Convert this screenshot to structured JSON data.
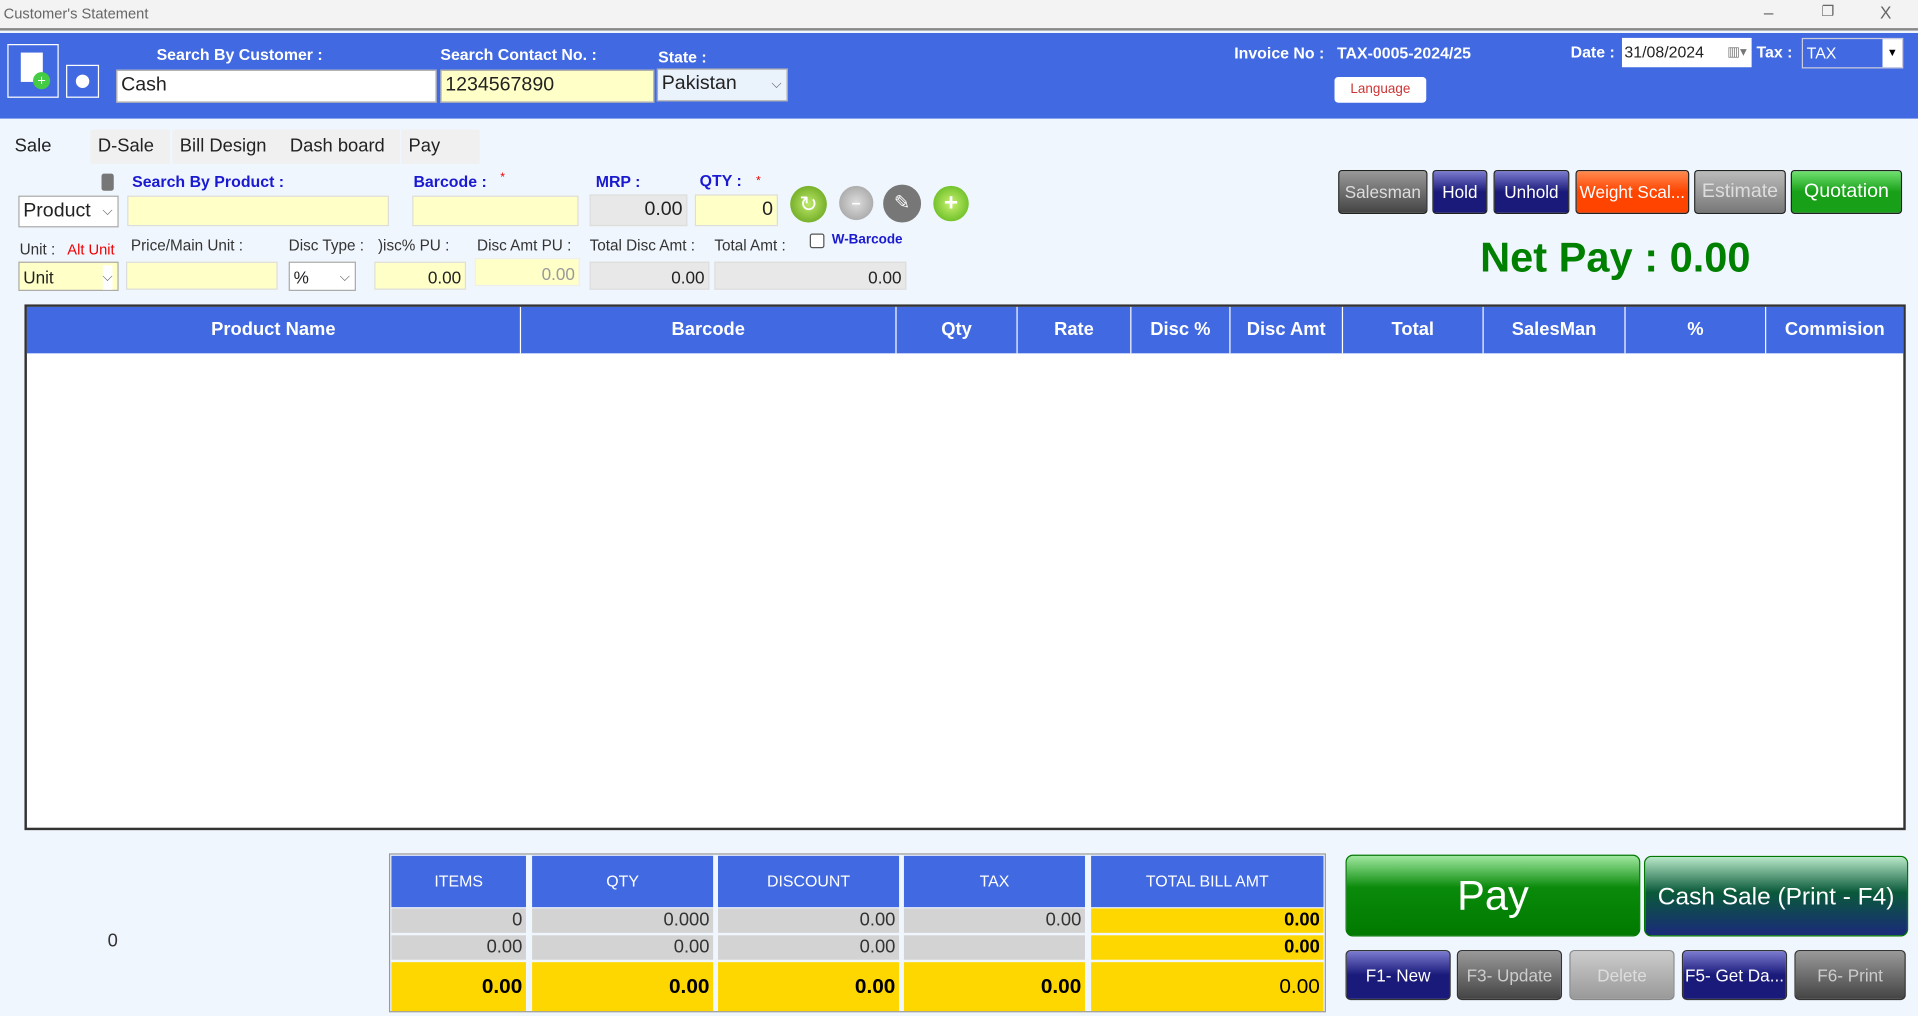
{
  "window": {
    "title": "Customer's Statement",
    "minimize": "–",
    "restore": "❐",
    "close": "X"
  },
  "header": {
    "search_customer_label": "Search By Customer :",
    "search_customer_value": "Cash",
    "search_contact_label": "Search Contact No. :",
    "search_contact_value": "1234567890",
    "state_label": "State :",
    "state_value": "Pakistan",
    "invoice_label": "Invoice No :",
    "invoice_value": "TAX-0005-2024/25",
    "language_button": "Language",
    "date_label": "Date :",
    "date_value": "31/08/2024",
    "tax_label": "Tax :",
    "tax_value": "TAX"
  },
  "tabs": [
    {
      "label": "Sale"
    },
    {
      "label": "D-Sale"
    },
    {
      "label": "Bill Design"
    },
    {
      "label": "Dash board"
    },
    {
      "label": "Pay"
    }
  ],
  "entry": {
    "product_type": "Product",
    "search_product_label": "Search By Product :",
    "search_product_value": "",
    "barcode_label": "Barcode :",
    "barcode_value": "",
    "required_mark": "*",
    "mrp_label": "MRP :",
    "mrp_value": "0.00",
    "qty_label": "QTY :",
    "qty_value": "0",
    "unit_label": "Unit :",
    "alt_unit_label": "Alt Unit",
    "unit_value": "Unit",
    "price_label": "Price/Main Unit :",
    "price_value": "",
    "disc_type_label": "Disc Type :",
    "disc_type_value": "%",
    "disc_pct_label": ")isc% PU :",
    "disc_pct_value": "0.00",
    "disc_amt_label": "Disc Amt PU :",
    "disc_amt_value": "0.00",
    "total_disc_label": "Total Disc Amt :",
    "total_disc_value": "0.00",
    "total_amt_label": "Total Amt :",
    "total_amt_value": "0.00",
    "wbarcode_label": "W-Barcode",
    "wbarcode_checked": false
  },
  "actions": {
    "salesman": "Salesman",
    "hold": "Hold",
    "unhold": "Unhold",
    "weight": "Weight Scal...",
    "estimate": "Estimate",
    "quotation": "Quotation"
  },
  "net_pay": "Net Pay : 0.00",
  "grid": {
    "columns": [
      "Product Name",
      "Barcode",
      "Qty",
      "Rate",
      "Disc %",
      "Disc Amt",
      "Total",
      "SalesMan",
      "%",
      "Commision"
    ],
    "rows": []
  },
  "left_count": "0",
  "summary": {
    "headers": [
      "ITEMS",
      "QTY",
      "DISCOUNT",
      "TAX",
      "TOTAL BILL AMT"
    ],
    "row1": [
      "0",
      "0.000",
      "0.00",
      "0.00",
      "0.00"
    ],
    "row2": [
      "0.00",
      "0.00",
      "0.00",
      "",
      "0.00"
    ],
    "row3": [
      "0.00",
      "0.00",
      "0.00",
      "0.00",
      "0.00"
    ]
  },
  "buttons": {
    "pay": "Pay",
    "cash_sale": "Cash Sale (Print - F4)",
    "new": "F1- New",
    "update": "F3- Update",
    "delete": "Delete",
    "get_data": "F5- Get Da...",
    "print": "F6- Print"
  },
  "colors": {
    "header_blue": "#4169e1",
    "net_pay_green": "#008000",
    "total_yellow": "#ffd700"
  }
}
